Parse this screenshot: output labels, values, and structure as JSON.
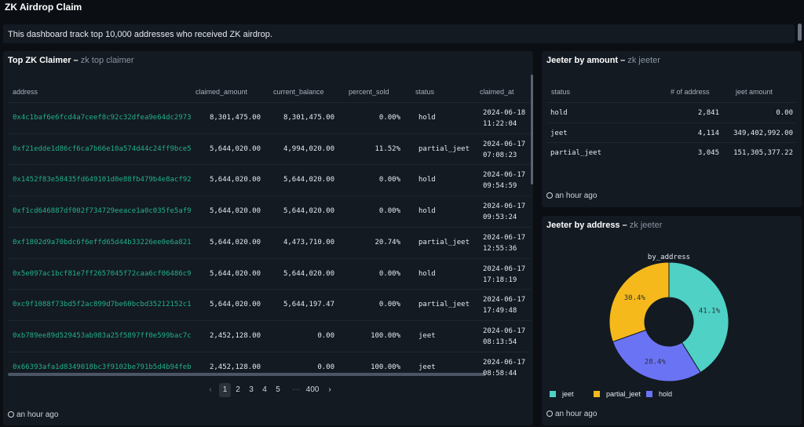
{
  "app": {
    "title": "ZK Airdrop Claim"
  },
  "description": "This dashboard track top 10,000 addresses who received ZK airdrop.",
  "top_claimers": {
    "title": "Top ZK Claimer",
    "subtitle": "zk top claimer",
    "columns": [
      "address",
      "claimed_amount",
      "current_balance",
      "percent_sold",
      "status",
      "claimed_at"
    ],
    "rows": [
      {
        "address": "0x4c1baf6e6fcd4a7ceef8c92c32dfea9e64dc2973",
        "claimed_amount": "8,301,475.00",
        "current_balance": "8,301,475.00",
        "percent_sold": "0.00%",
        "status": "hold",
        "date": "2024-06-18",
        "time": "11:22:04"
      },
      {
        "address": "0xf21edde1d86cf6ca7b66e10a574d44c24ff9bce5",
        "claimed_amount": "5,644,020.00",
        "current_balance": "4,994,020.00",
        "percent_sold": "11.52%",
        "status": "partial_jeet",
        "date": "2024-06-17",
        "time": "07:08:23"
      },
      {
        "address": "0x1452f83e58435fd649101d0e88fb479b4e8acf92",
        "claimed_amount": "5,644,020.00",
        "current_balance": "5,644,020.00",
        "percent_sold": "0.00%",
        "status": "hold",
        "date": "2024-06-17",
        "time": "09:54:59"
      },
      {
        "address": "0xf1cd646887df002f734729eeace1a0c035fe5af9",
        "claimed_amount": "5,644,020.00",
        "current_balance": "5,644,020.00",
        "percent_sold": "0.00%",
        "status": "hold",
        "date": "2024-06-17",
        "time": "09:53:24"
      },
      {
        "address": "0xf1802d9a70bdc6f6effd65d44b33226ee0e6a821",
        "claimed_amount": "5,644,020.00",
        "current_balance": "4,473,710.00",
        "percent_sold": "20.74%",
        "status": "partial_jeet",
        "date": "2024-06-17",
        "time": "12:55:36"
      },
      {
        "address": "0x5e097ac1bcf81e7ff2657045f72caa6cf06486c9",
        "claimed_amount": "5,644,020.00",
        "current_balance": "5,644,020.00",
        "percent_sold": "0.00%",
        "status": "hold",
        "date": "2024-06-17",
        "time": "17:18:19"
      },
      {
        "address": "0xc9f1088f73bd5f2ac899d7be60bcbd35212152c1",
        "claimed_amount": "5,644,020.00",
        "current_balance": "5,644,197.47",
        "percent_sold": "0.00%",
        "status": "partial_jeet",
        "date": "2024-06-17",
        "time": "17:49:48"
      },
      {
        "address": "0xb789ee89d529453ab983a25f5897ff0e599bac7c",
        "claimed_amount": "2,452,128.00",
        "current_balance": "0.00",
        "percent_sold": "100.00%",
        "status": "jeet",
        "date": "2024-06-17",
        "time": "08:13:54"
      },
      {
        "address": "0x66393afa1d8349018bc3f9102be791b5d4b94feb",
        "claimed_amount": "2,452,128.00",
        "current_balance": "0.00",
        "percent_sold": "100.00%",
        "status": "jeet",
        "date": "2024-06-17",
        "time": "08:58:44"
      }
    ],
    "pagination": {
      "prev": "‹",
      "pages": [
        "1",
        "2",
        "3",
        "4",
        "5"
      ],
      "ellipsis": "···",
      "last": "400",
      "next": "›",
      "current": "1"
    },
    "updated": "an hour ago"
  },
  "jeeter_amount": {
    "title": "Jeeter by amount",
    "subtitle": "zk jeeter",
    "columns": [
      "status",
      "# of address",
      "jeet amount"
    ],
    "rows": [
      {
        "status": "hold",
        "count": "2,841",
        "amount": "0.00"
      },
      {
        "status": "jeet",
        "count": "4,114",
        "amount": "349,402,992.00"
      },
      {
        "status": "partial_jeet",
        "count": "3,045",
        "amount": "151,305,377.22"
      }
    ],
    "updated": "an hour ago"
  },
  "jeeter_address": {
    "title": "Jeeter by address",
    "subtitle": "zk jeeter",
    "updated": "an hour ago",
    "chart_data": {
      "type": "pie",
      "title": "by_address",
      "categories": [
        "jeet",
        "hold",
        "partial_jeet"
      ],
      "values": [
        41.1,
        28.4,
        30.4
      ],
      "labels": [
        "41.1%",
        "28.4%",
        "30.4%"
      ],
      "colors": [
        "#4fd1c5",
        "#6b73f5",
        "#f5b91b"
      ],
      "donut": true,
      "legend": [
        "jeet",
        "partial_jeet",
        "hold"
      ],
      "legend_colors": [
        "#4fd1c5",
        "#f5b91b",
        "#6b73f5"
      ],
      "legend_position": "bottom"
    }
  }
}
